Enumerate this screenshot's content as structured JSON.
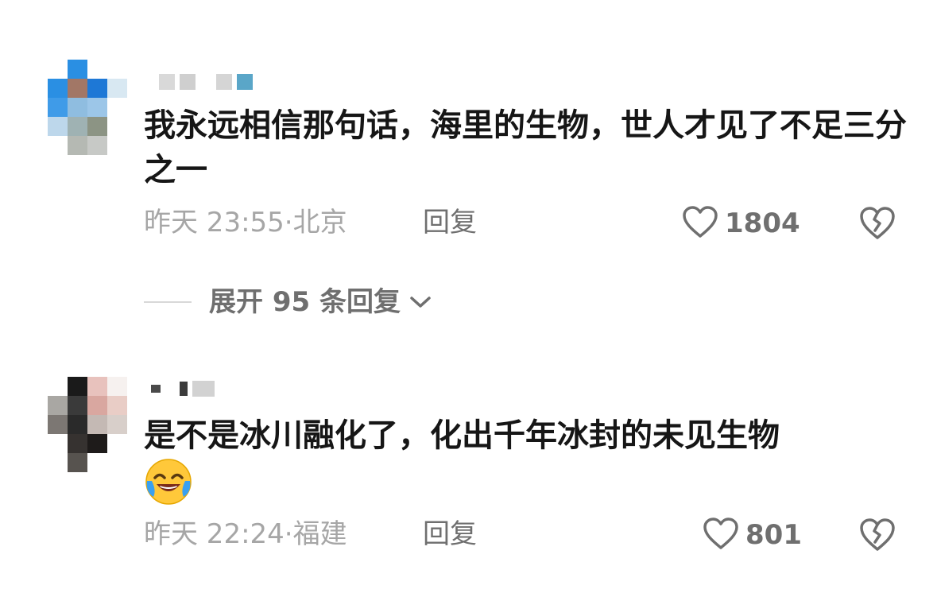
{
  "comments": [
    {
      "text": "我永远相信那句话，海里的生物，世人才见了不足三分之一",
      "time": "昨天 23:55",
      "location": "北京",
      "reply_label": "回复",
      "likes": "1804",
      "replies_toggle": "展开 95 条回复"
    },
    {
      "text": "是不是冰川融化了，化出千年冰封的未见生物",
      "emoji": "laughing-crying-emoji",
      "time": "昨天 22:24",
      "location": "福建",
      "reply_label": "回复",
      "likes": "801"
    }
  ],
  "icons": {
    "like": "heart-outline-icon",
    "dislike": "broken-heart-icon",
    "expand": "chevron-down-icon"
  },
  "colors": {
    "text": "#161616",
    "meta": "#a6a6a6",
    "action": "#6f6f6f",
    "emoji_yellow": "#ffc83a"
  }
}
